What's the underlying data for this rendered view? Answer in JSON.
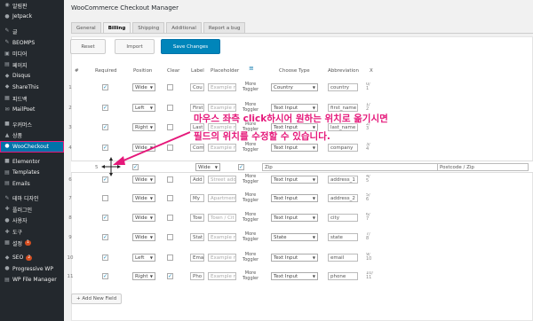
{
  "sidebar": {
    "items": [
      {
        "label": "알림판",
        "icon": "dashboard-icon",
        "glyph": "◉"
      },
      {
        "label": "Jetpack",
        "icon": "jetpack-icon",
        "glyph": "●"
      },
      {
        "label": "글",
        "icon": "pin-icon",
        "glyph": "✎",
        "gap": true
      },
      {
        "label": "BEOMPS",
        "icon": "pin-icon",
        "glyph": "✎"
      },
      {
        "label": "미디어",
        "icon": "media-icon",
        "glyph": "▣"
      },
      {
        "label": "페이지",
        "icon": "page-icon",
        "glyph": "▤"
      },
      {
        "label": "Disqus",
        "icon": "comment-icon",
        "glyph": "◆"
      },
      {
        "label": "ShareThis",
        "icon": "share-icon",
        "glyph": "◆"
      },
      {
        "label": "피드백",
        "icon": "feedback-icon",
        "glyph": "▦"
      },
      {
        "label": "MailPoet",
        "icon": "mail-icon",
        "glyph": "✉"
      },
      {
        "label": "우커머스",
        "icon": "woocommerce-icon",
        "glyph": "■",
        "gap": true
      },
      {
        "label": "상품",
        "icon": "products-icon",
        "glyph": "▲"
      },
      {
        "label": "WooCheckout",
        "icon": "user-icon",
        "glyph": "●",
        "active": true
      },
      {
        "label": "Elementor",
        "icon": "elementor-icon",
        "glyph": "■",
        "gap": true
      },
      {
        "label": "Templates",
        "icon": "templates-icon",
        "glyph": "▤"
      },
      {
        "label": "Emails",
        "icon": "emails-icon",
        "glyph": "▤"
      },
      {
        "label": "테마 디자인",
        "icon": "appearance-icon",
        "glyph": "✎",
        "gap": true
      },
      {
        "label": "플러그인",
        "icon": "plugins-icon",
        "glyph": "✚"
      },
      {
        "label": "사용자",
        "icon": "users-icon",
        "glyph": "●"
      },
      {
        "label": "도구",
        "icon": "tools-icon",
        "glyph": "✚"
      },
      {
        "label": "설정",
        "icon": "settings-icon",
        "glyph": "▦",
        "badge": "1"
      },
      {
        "label": "SEO",
        "icon": "seo-icon",
        "glyph": "◆",
        "badge": "2",
        "gap": true
      },
      {
        "label": "Progressive WP",
        "icon": "progressive-wp-icon",
        "glyph": "●"
      },
      {
        "label": "WP File Manager",
        "icon": "file-manager-icon",
        "glyph": "▤"
      }
    ]
  },
  "page_title": "WooCommerce Checkout Manager",
  "tabs": [
    "General",
    "Billing",
    "Shipping",
    "Additional",
    "Report a bug"
  ],
  "buttons": {
    "reset": "Reset",
    "import": "Import",
    "save": "Save Changes",
    "add": "+ Add New Field"
  },
  "headers": {
    "num": "#",
    "required": "Required",
    "position": "Position",
    "clear": "Clear",
    "label": "Label",
    "placeholder": "Placeholder",
    "choose_type": "Choose Type",
    "abbreviation": "Abbreviation",
    "x": "X"
  },
  "rows": [
    {
      "num": "1",
      "required": true,
      "position": "Wide",
      "clear": false,
      "label": "Cou",
      "placeholder": "Example n",
      "toggler": [
        "More",
        "Toggler"
      ],
      "type": "Country",
      "abbr": "country",
      "idx": [
        "0/",
        "1"
      ]
    },
    {
      "num": "2",
      "required": true,
      "position": "Left",
      "clear": false,
      "label": "First",
      "placeholder": "Example n",
      "toggler": [
        "More",
        "Toggler"
      ],
      "type": "Text Input",
      "abbr": "first_name",
      "idx": [
        "1/",
        "2"
      ]
    },
    {
      "num": "3",
      "required": true,
      "position": "Right",
      "clear": false,
      "label": "Last",
      "placeholder": "Example n",
      "toggler": [
        "More",
        "Toggler"
      ],
      "type": "Text Input",
      "abbr": "last_name",
      "idx": [
        "2/",
        "3"
      ]
    },
    {
      "num": "4",
      "required": true,
      "position": "Wide",
      "clear": false,
      "label": "Com",
      "placeholder": "Example n",
      "toggler": [
        "More",
        "Toggler"
      ],
      "type": "Text Input",
      "abbr": "company",
      "idx": [
        "3/",
        "4"
      ]
    },
    {
      "num": "6",
      "required": true,
      "position": "Wide",
      "clear": false,
      "label": "Add",
      "placeholder": "Street add",
      "toggler": [
        "More",
        "Toggler"
      ],
      "type": "Text Input",
      "abbr": "address_1",
      "idx": [
        "4/",
        "5"
      ]
    },
    {
      "num": "7",
      "required": false,
      "position": "Wide",
      "clear": false,
      "label": "My",
      "placeholder": "Apartment",
      "toggler": [
        "More",
        "Toggler"
      ],
      "type": "Text Input",
      "abbr": "address_2",
      "idx": [
        "5/",
        "6"
      ]
    },
    {
      "num": "8",
      "required": true,
      "position": "Wide",
      "clear": false,
      "label": "Tow",
      "placeholder": "Town / Cit",
      "toggler": [
        "More",
        "Toggler"
      ],
      "type": "Text Input",
      "abbr": "city",
      "idx": [
        "6/",
        "7"
      ]
    },
    {
      "num": "9",
      "required": true,
      "position": "Wide",
      "clear": false,
      "label": "Stat",
      "placeholder": "Example n",
      "toggler": [
        "More",
        "Toggler"
      ],
      "type": "State",
      "abbr": "state",
      "idx": [
        "7/",
        "8"
      ]
    },
    {
      "num": "10",
      "required": true,
      "position": "Left",
      "clear": false,
      "label": "Ema",
      "placeholder": "Example n",
      "toggler": [
        "More",
        "Toggler"
      ],
      "type": "Text Input",
      "abbr": "email",
      "idx": [
        "9/",
        "10"
      ]
    },
    {
      "num": "11",
      "required": true,
      "position": "Right",
      "clear": true,
      "label": "Pho",
      "placeholder": "Example n",
      "toggler": [
        "More",
        "Toggler"
      ],
      "type": "Text Input",
      "abbr": "phone",
      "idx": [
        "10/",
        "11"
      ]
    }
  ],
  "drag_row": {
    "num": "5",
    "required": true,
    "position": "Wide",
    "clear": true,
    "label": "Zip",
    "abbr": "Postcode / Zip"
  },
  "annotation": {
    "line1": "마우스 좌측 click하시어 원하는 위치로 옮기시면",
    "line2": "필드의 위치를 수정할 수 있습니다.",
    "color": "#e5187a"
  },
  "colors": {
    "accent": "#0085ba",
    "sidebar": "#23282d",
    "highlight": "#e5187a"
  }
}
